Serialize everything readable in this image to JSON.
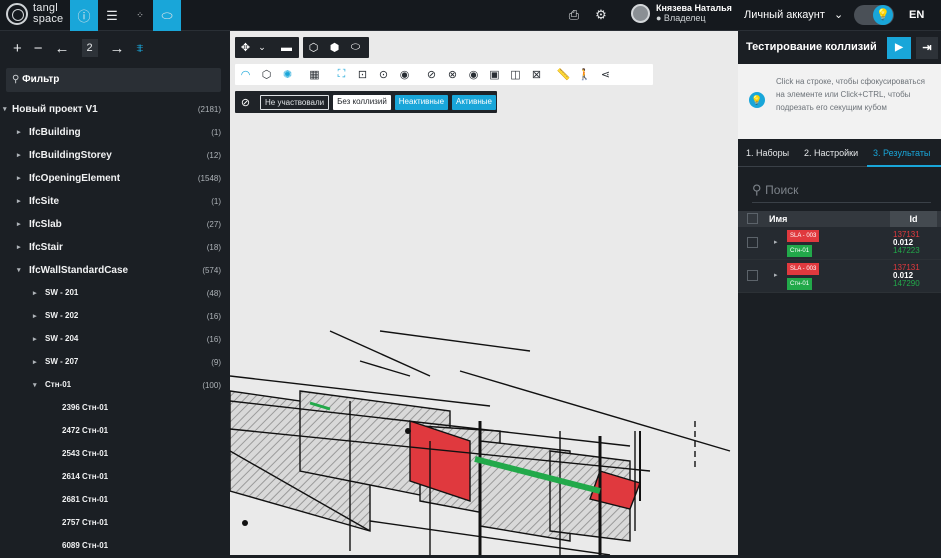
{
  "topbar": {
    "logo_line1": "tangl",
    "logo_line2": "space",
    "user_name": "Князева Наталья",
    "user_role": "● Владелец",
    "account": "Личный аккаунт",
    "lang": "EN"
  },
  "left": {
    "level": "2",
    "filter_placeholder": "Фильтр",
    "tree": [
      {
        "label": "Новый проект V1",
        "count": "(2181)",
        "indent": 0,
        "open": true
      },
      {
        "label": "IfcBuilding",
        "count": "(1)",
        "indent": 1,
        "open": false
      },
      {
        "label": "IfcBuildingStorey",
        "count": "(12)",
        "indent": 1,
        "open": false
      },
      {
        "label": "IfcOpeningElement",
        "count": "(1548)",
        "indent": 1,
        "open": false
      },
      {
        "label": "IfcSite",
        "count": "(1)",
        "indent": 1,
        "open": false
      },
      {
        "label": "IfcSlab",
        "count": "(27)",
        "indent": 1,
        "open": false
      },
      {
        "label": "IfcStair",
        "count": "(18)",
        "indent": 1,
        "open": false
      },
      {
        "label": "IfcWallStandardCase",
        "count": "(574)",
        "indent": 1,
        "open": true
      },
      {
        "label": "SW - 201",
        "count": "(48)",
        "indent": 2,
        "open": false
      },
      {
        "label": "SW - 202",
        "count": "(16)",
        "indent": 2,
        "open": false
      },
      {
        "label": "SW - 204",
        "count": "(16)",
        "indent": 2,
        "open": false
      },
      {
        "label": "SW - 207",
        "count": "(9)",
        "indent": 2,
        "open": false
      },
      {
        "label": "Стн-01",
        "count": "(100)",
        "indent": 2,
        "open": true
      },
      {
        "label": "2396 Стн-01",
        "count": "",
        "indent": 3
      },
      {
        "label": "2472 Стн-01",
        "count": "",
        "indent": 3
      },
      {
        "label": "2543 Стн-01",
        "count": "",
        "indent": 3
      },
      {
        "label": "2614 Стн-01",
        "count": "",
        "indent": 3
      },
      {
        "label": "2681 Стн-01",
        "count": "",
        "indent": 3
      },
      {
        "label": "2757 Стн-01",
        "count": "",
        "indent": 3
      },
      {
        "label": "6089 Стн-01",
        "count": "",
        "indent": 3
      }
    ]
  },
  "viewport": {
    "filter_chips": [
      "Не участвовали",
      "Без коллизий",
      "Неактивные",
      "Активные"
    ]
  },
  "right": {
    "title": "Тестирование коллизий",
    "hint": "Click на строке, чтобы сфокусироваться на элементе или Click+CTRL, чтобы подрезать его секущим кубом",
    "tabs": [
      "1. Наборы",
      "2. Настройки",
      "3. Результаты"
    ],
    "search_placeholder": "Поиск",
    "col_name": "Имя",
    "col_id": "Id",
    "results": [
      {
        "a": "SLA - 003",
        "b": "Стн-01",
        "id1": "137131",
        "dist": "0.012",
        "id2": "147223"
      },
      {
        "a": "SLA - 003",
        "b": "Стн-01",
        "id1": "137131",
        "dist": "0.012",
        "id2": "147290"
      }
    ]
  },
  "colors": {
    "accent": "#19a6d9",
    "clash_red": "#e0393e",
    "clash_green": "#22a94a"
  }
}
